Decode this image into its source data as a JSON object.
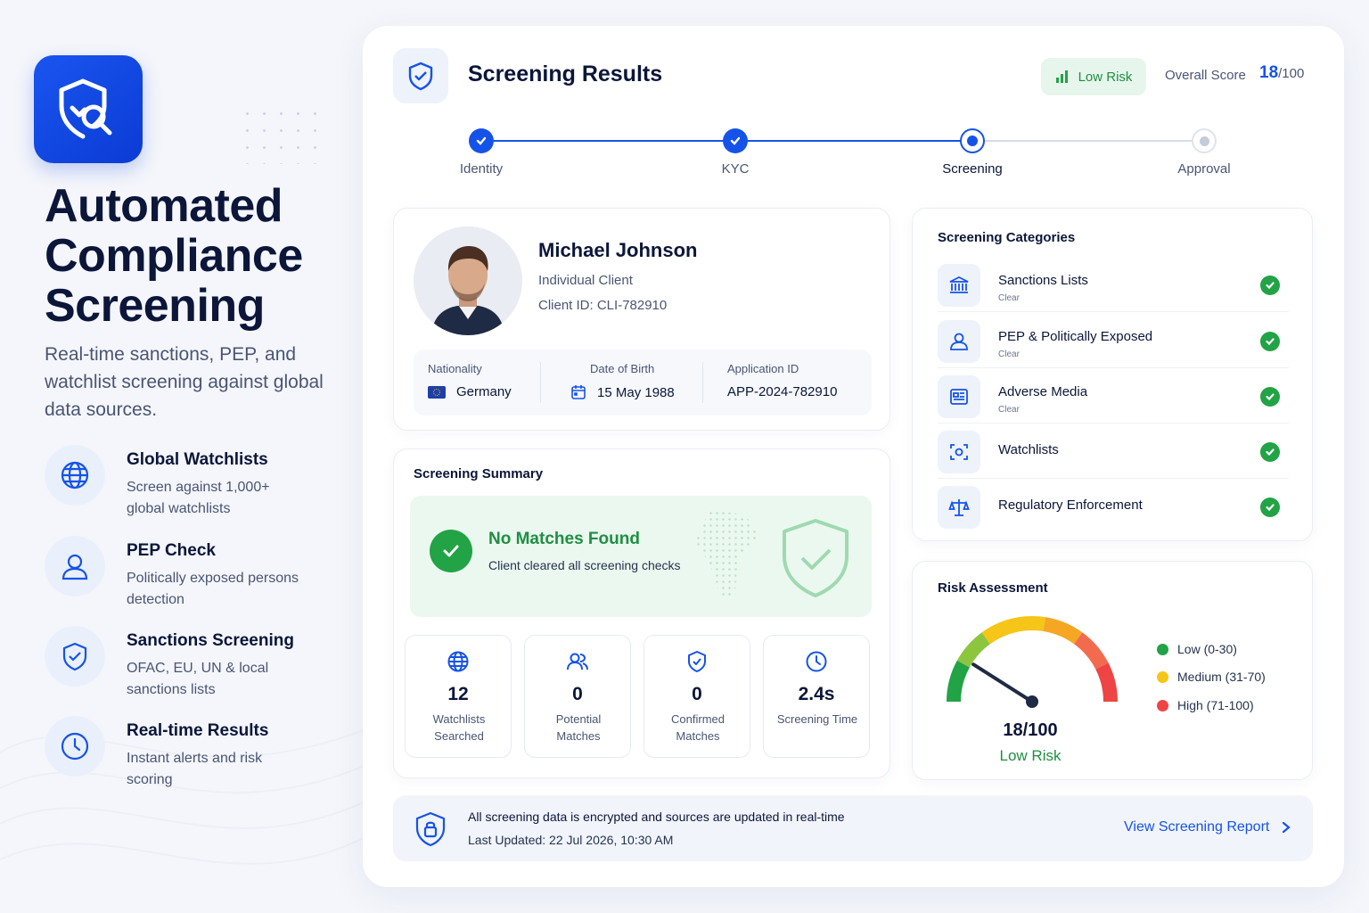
{
  "hero": {
    "title_line1": "Automated",
    "title_line2": "Compliance",
    "title_line3": "Screening",
    "subtitle": "Real-time sanctions, PEP, and watchlist screening against global data sources.",
    "logo_icon": "shield-search-icon",
    "brand_color": "#1553e8"
  },
  "features": [
    {
      "title": "Global Watchlists",
      "desc": "Screen against 1,000+ global watchlists",
      "icon": "globe-icon"
    },
    {
      "title": "PEP Check",
      "desc": "Politically exposed persons detection",
      "icon": "person-icon"
    },
    {
      "title": "Sanctions Screening",
      "desc": "OFAC, EU, UN & local sanctions lists",
      "icon": "shield-check-icon"
    },
    {
      "title": "Real-time Results",
      "desc": "Instant alerts and risk scoring",
      "icon": "clock-icon"
    }
  ],
  "header": {
    "title": "Screening Results",
    "risk_chip": "Low Risk",
    "overall_label": "Overall Score",
    "overall_score": "18",
    "overall_denominator": "/100"
  },
  "steps": [
    {
      "label": "Identity",
      "state": "done"
    },
    {
      "label": "KYC",
      "state": "done"
    },
    {
      "label": "Screening",
      "state": "current"
    },
    {
      "label": "Approval",
      "state": "pending"
    }
  ],
  "profile": {
    "name": "Michael Johnson",
    "type": "Individual Client",
    "client_id": "Client ID: CLI-782910",
    "nationality_label": "Nationality",
    "nationality": "Germany",
    "dob_label": "Date of Birth",
    "dob": "15 May 1988",
    "application_label": "Application ID",
    "application_id": "APP-2024-782910"
  },
  "summary": {
    "title": "Screening Summary",
    "result_title": "No Matches Found",
    "result_sub": "Client cleared all screening checks",
    "stats": [
      {
        "value": "12",
        "label": "Watchlists Searched",
        "icon": "globe-icon"
      },
      {
        "value": "0",
        "label": "Potential Matches",
        "icon": "users-icon"
      },
      {
        "value": "0",
        "label": "Confirmed Matches",
        "icon": "shield-check-icon"
      },
      {
        "value": "2.4s",
        "label": "Screening Time",
        "icon": "clock-icon"
      }
    ]
  },
  "categories": {
    "title": "Screening Categories",
    "items": [
      {
        "name": "Sanctions Lists",
        "status": "Clear",
        "icon": "bank-icon"
      },
      {
        "name": "PEP & Politically Exposed",
        "status": "Clear",
        "icon": "person-icon"
      },
      {
        "name": "Adverse Media",
        "status": "Clear",
        "icon": "newspaper-icon"
      },
      {
        "name": "Watchlists",
        "status": "",
        "icon": "scan-eye-icon"
      },
      {
        "name": "Regulatory Enforcement",
        "status": "",
        "icon": "scales-icon"
      }
    ]
  },
  "risk": {
    "title": "Risk Assessment",
    "score": 18,
    "score_text": "18/100",
    "level": "Low Risk",
    "legend": [
      {
        "label": "Low (0-30)",
        "color": "#22a346"
      },
      {
        "label": "Medium (31-70)",
        "color": "#f5c518"
      },
      {
        "label": "High (71-100)",
        "color": "#ef4444"
      }
    ]
  },
  "footer": {
    "line1": "All screening data is encrypted and sources are updated in real-time",
    "line2": "Last Updated: 22 Jul 2026, 10:30 AM",
    "link": "View Screening Report"
  }
}
